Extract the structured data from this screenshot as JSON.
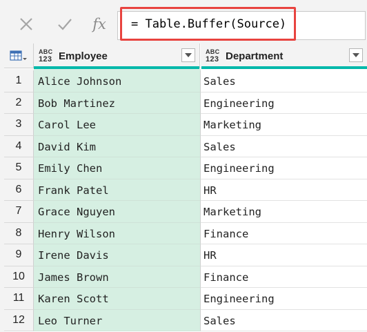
{
  "formula_bar": {
    "cancel_icon": "x-icon",
    "commit_icon": "check-icon",
    "fx_label": "fx",
    "formula": "= Table.Buffer(Source)"
  },
  "table": {
    "columns": [
      {
        "type_top": "ABC",
        "type_bottom": "123",
        "name": "Employee"
      },
      {
        "type_top": "ABC",
        "type_bottom": "123",
        "name": "Department"
      }
    ],
    "rows": [
      {
        "n": "1",
        "employee": "Alice Johnson",
        "department": "Sales"
      },
      {
        "n": "2",
        "employee": "Bob Martinez",
        "department": "Engineering"
      },
      {
        "n": "3",
        "employee": "Carol Lee",
        "department": "Marketing"
      },
      {
        "n": "4",
        "employee": "David Kim",
        "department": "Sales"
      },
      {
        "n": "5",
        "employee": "Emily Chen",
        "department": "Engineering"
      },
      {
        "n": "6",
        "employee": "Frank Patel",
        "department": "HR"
      },
      {
        "n": "7",
        "employee": "Grace Nguyen",
        "department": "Marketing"
      },
      {
        "n": "8",
        "employee": "Henry Wilson",
        "department": "Finance"
      },
      {
        "n": "9",
        "employee": "Irene Davis",
        "department": "HR"
      },
      {
        "n": "10",
        "employee": "James Brown",
        "department": "Finance"
      },
      {
        "n": "11",
        "employee": "Karen Scott",
        "department": "Engineering"
      },
      {
        "n": "12",
        "employee": "Leo Turner",
        "department": "Sales"
      }
    ]
  },
  "colors": {
    "highlight": "#e8433f",
    "selected_column": "#d6efe2",
    "quality_bar": "#01b8aa"
  }
}
